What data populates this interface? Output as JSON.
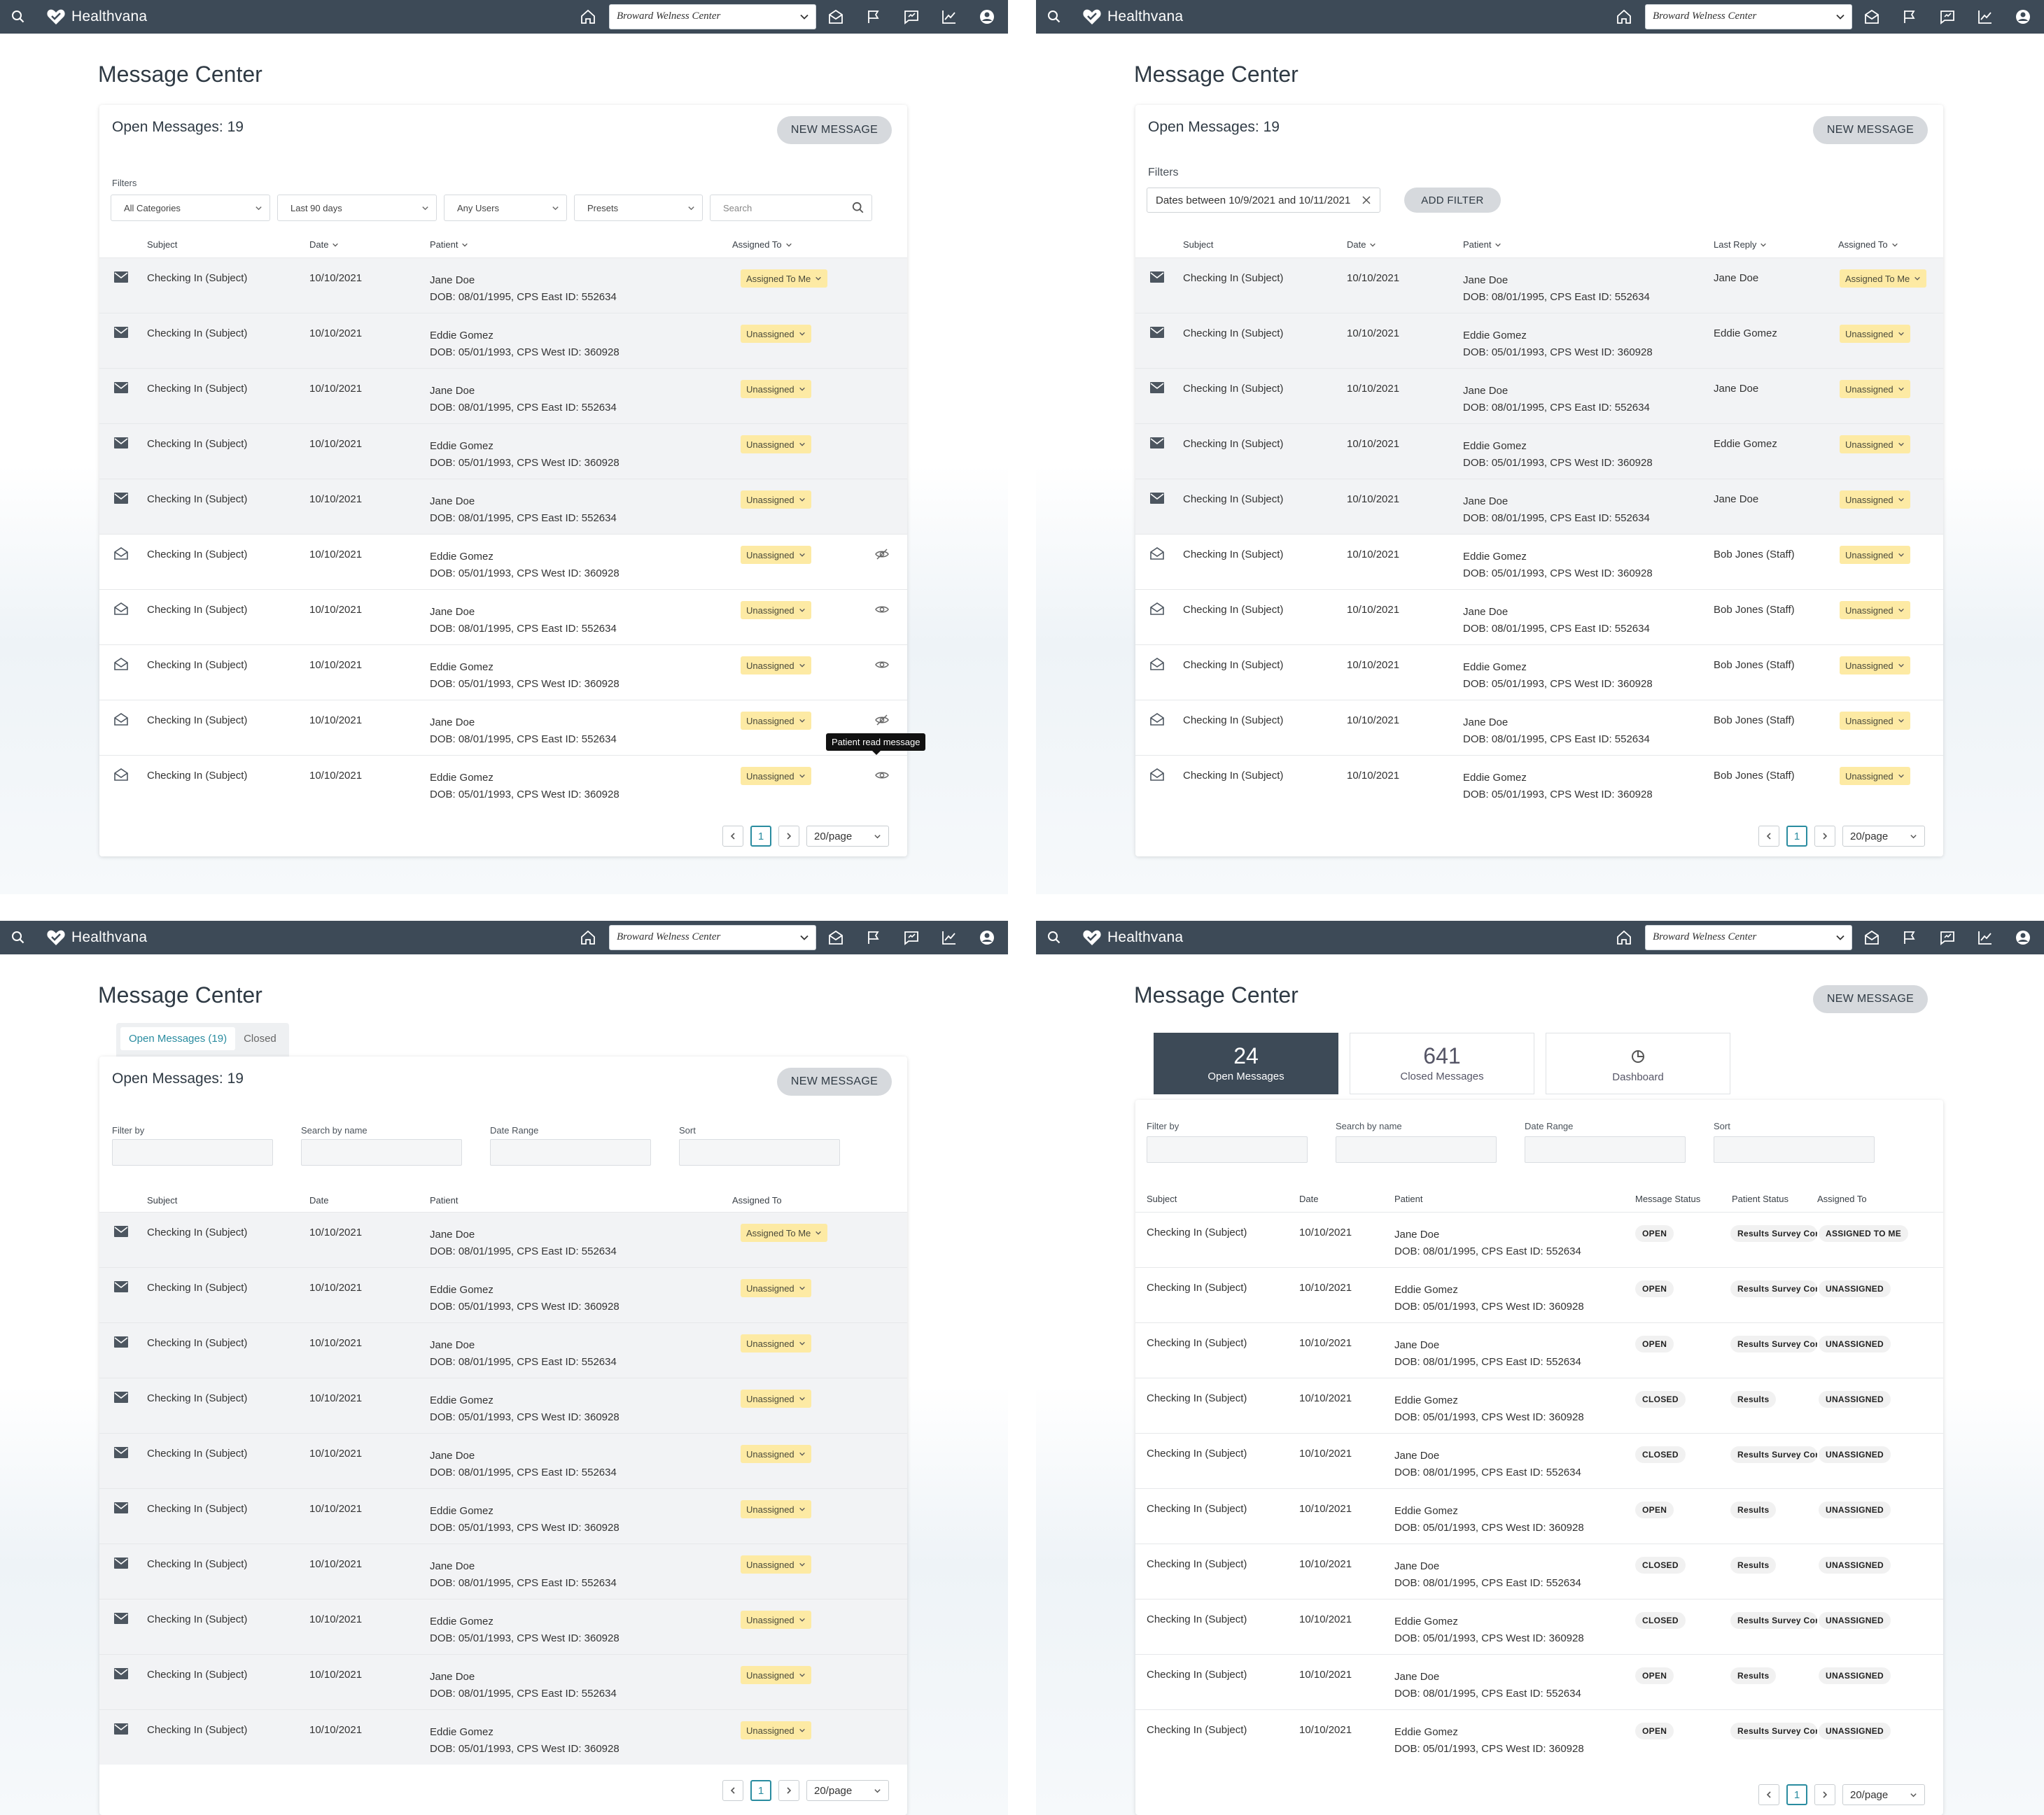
{
  "app": {
    "name": "Healthvana",
    "location": "Broward Welness Center"
  },
  "page_title": "Message Center",
  "open_messages_label": "Open Messages: 19",
  "new_message_label": "NEW MESSAGE",
  "filters_label": "Filters",
  "panel1": {
    "filters": [
      "All Categories",
      "Last 90 days",
      "Any Users",
      "Presets"
    ],
    "search_placeholder": "Search",
    "columns": [
      "Subject",
      "Date",
      "Patient",
      "Assigned To"
    ],
    "tooltip": "Patient read message"
  },
  "panel2": {
    "filter_chip": "Dates between 10/9/2021 and 10/11/2021",
    "add_filter_label": "ADD FILTER",
    "columns": [
      "Subject",
      "Date",
      "Patient",
      "Last Reply",
      "Assigned To"
    ],
    "last_replies": [
      "Jane Doe",
      "Eddie Gomez",
      "Jane Doe",
      "Eddie Gomez",
      "Jane Doe",
      "Bob Jones (Staff)",
      "Bob Jones (Staff)",
      "Bob Jones (Staff)",
      "Bob Jones (Staff)",
      "Bob Jones (Staff)"
    ]
  },
  "panel3": {
    "tabs": [
      "Open Messages (19)",
      "Closed"
    ],
    "filter_labels": [
      "Filter by",
      "Search by name",
      "Date Range",
      "Sort"
    ],
    "columns": [
      "Subject",
      "Date",
      "Patient",
      "Assigned To"
    ]
  },
  "panel4": {
    "stats": [
      {
        "num": "24",
        "label": "Open Messages"
      },
      {
        "num": "641",
        "label": "Closed Messages"
      },
      {
        "num": "",
        "label": "Dashboard"
      }
    ],
    "filter_labels": [
      "Filter by",
      "Search by name",
      "Date Range",
      "Sort"
    ],
    "columns": [
      "Subject",
      "Date",
      "Patient",
      "Message Status",
      "Patient Status",
      "Assigned To"
    ],
    "message_status": [
      "OPEN",
      "OPEN",
      "OPEN",
      "CLOSED",
      "CLOSED",
      "OPEN",
      "CLOSED",
      "CLOSED",
      "OPEN",
      "OPEN"
    ],
    "patient_status": [
      "Results Survey Cor..",
      "Results Survey Cor..",
      "Results Survey Cor..",
      "Results",
      "Results Survey Cor..",
      "Results",
      "Results",
      "Results Survey Cor..",
      "Results",
      "Results Survey Cor.."
    ],
    "assigned": [
      "ASSIGNED TO ME",
      "UNASSIGNED",
      "UNASSIGNED",
      "UNASSIGNED",
      "UNASSIGNED",
      "UNASSIGNED",
      "UNASSIGNED",
      "UNASSIGNED",
      "UNASSIGNED",
      "UNASSIGNED"
    ]
  },
  "rows": [
    {
      "subject": "Checking In (Subject)",
      "date": "10/10/2021",
      "name": "Jane Doe",
      "dob": "DOB: 08/01/1995, CPS East ID: 552634",
      "assigned": "Assigned To Me"
    },
    {
      "subject": "Checking In (Subject)",
      "date": "10/10/2021",
      "name": "Eddie Gomez",
      "dob": "DOB: 05/01/1993, CPS West ID: 360928",
      "assigned": "Unassigned"
    },
    {
      "subject": "Checking In (Subject)",
      "date": "10/10/2021",
      "name": "Jane Doe",
      "dob": "DOB: 08/01/1995, CPS East ID: 552634",
      "assigned": "Unassigned"
    },
    {
      "subject": "Checking In (Subject)",
      "date": "10/10/2021",
      "name": "Eddie Gomez",
      "dob": "DOB: 05/01/1993, CPS West ID: 360928",
      "assigned": "Unassigned"
    },
    {
      "subject": "Checking In (Subject)",
      "date": "10/10/2021",
      "name": "Jane Doe",
      "dob": "DOB: 08/01/1995, CPS East ID: 552634",
      "assigned": "Unassigned"
    },
    {
      "subject": "Checking In (Subject)",
      "date": "10/10/2021",
      "name": "Eddie Gomez",
      "dob": "DOB: 05/01/1993, CPS West ID: 360928",
      "assigned": "Unassigned"
    },
    {
      "subject": "Checking In (Subject)",
      "date": "10/10/2021",
      "name": "Jane Doe",
      "dob": "DOB: 08/01/1995, CPS East ID: 552634",
      "assigned": "Unassigned"
    },
    {
      "subject": "Checking In (Subject)",
      "date": "10/10/2021",
      "name": "Eddie Gomez",
      "dob": "DOB: 05/01/1993, CPS West ID: 360928",
      "assigned": "Unassigned"
    },
    {
      "subject": "Checking In (Subject)",
      "date": "10/10/2021",
      "name": "Jane Doe",
      "dob": "DOB: 08/01/1995, CPS East ID: 552634",
      "assigned": "Unassigned"
    },
    {
      "subject": "Checking In (Subject)",
      "date": "10/10/2021",
      "name": "Eddie Gomez",
      "dob": "DOB: 05/01/1993, CPS West ID: 360928",
      "assigned": "Unassigned"
    }
  ],
  "pagination": {
    "page": "1",
    "per_page": "20/page"
  },
  "colors": {
    "topbar": "#3d4a57",
    "accent": "#2a8ca0",
    "assigned_pill": "#fdeaa4"
  }
}
